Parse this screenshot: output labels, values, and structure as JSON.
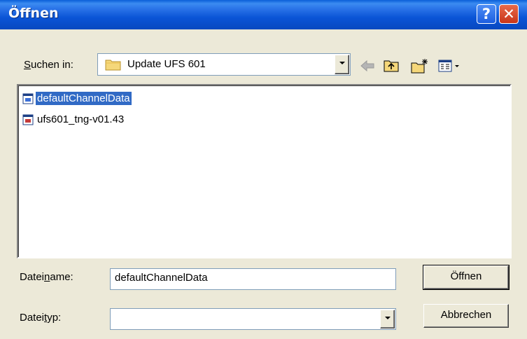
{
  "window": {
    "title": "Öffnen"
  },
  "titlebar": {
    "help_label": "?",
    "close_label": "✕"
  },
  "lookin": {
    "label_prefix": "",
    "label_key": "S",
    "label_rest": "uchen in:",
    "value": "Update UFS 601"
  },
  "toolbar": {
    "icons": [
      "back-arrow-icon",
      "up-folder-icon",
      "new-folder-icon",
      "view-menu-icon"
    ]
  },
  "files": [
    {
      "name": "defaultChannelData",
      "selected": true
    },
    {
      "name": "ufs601_tng-v01.43",
      "selected": false
    }
  ],
  "filename": {
    "label_prefix": "Datei",
    "label_key": "n",
    "label_rest": "ame:",
    "value": "defaultChannelData"
  },
  "filetype": {
    "label_prefix": "Datei",
    "label_key": "t",
    "label_rest": "yp:",
    "value": ""
  },
  "buttons": {
    "open_label": "Öffnen",
    "cancel_label": "Abbrechen"
  },
  "colors": {
    "title_bar": "#0A54D6",
    "selection": "#316AC5",
    "dialog_bg": "#ECE9D8"
  }
}
